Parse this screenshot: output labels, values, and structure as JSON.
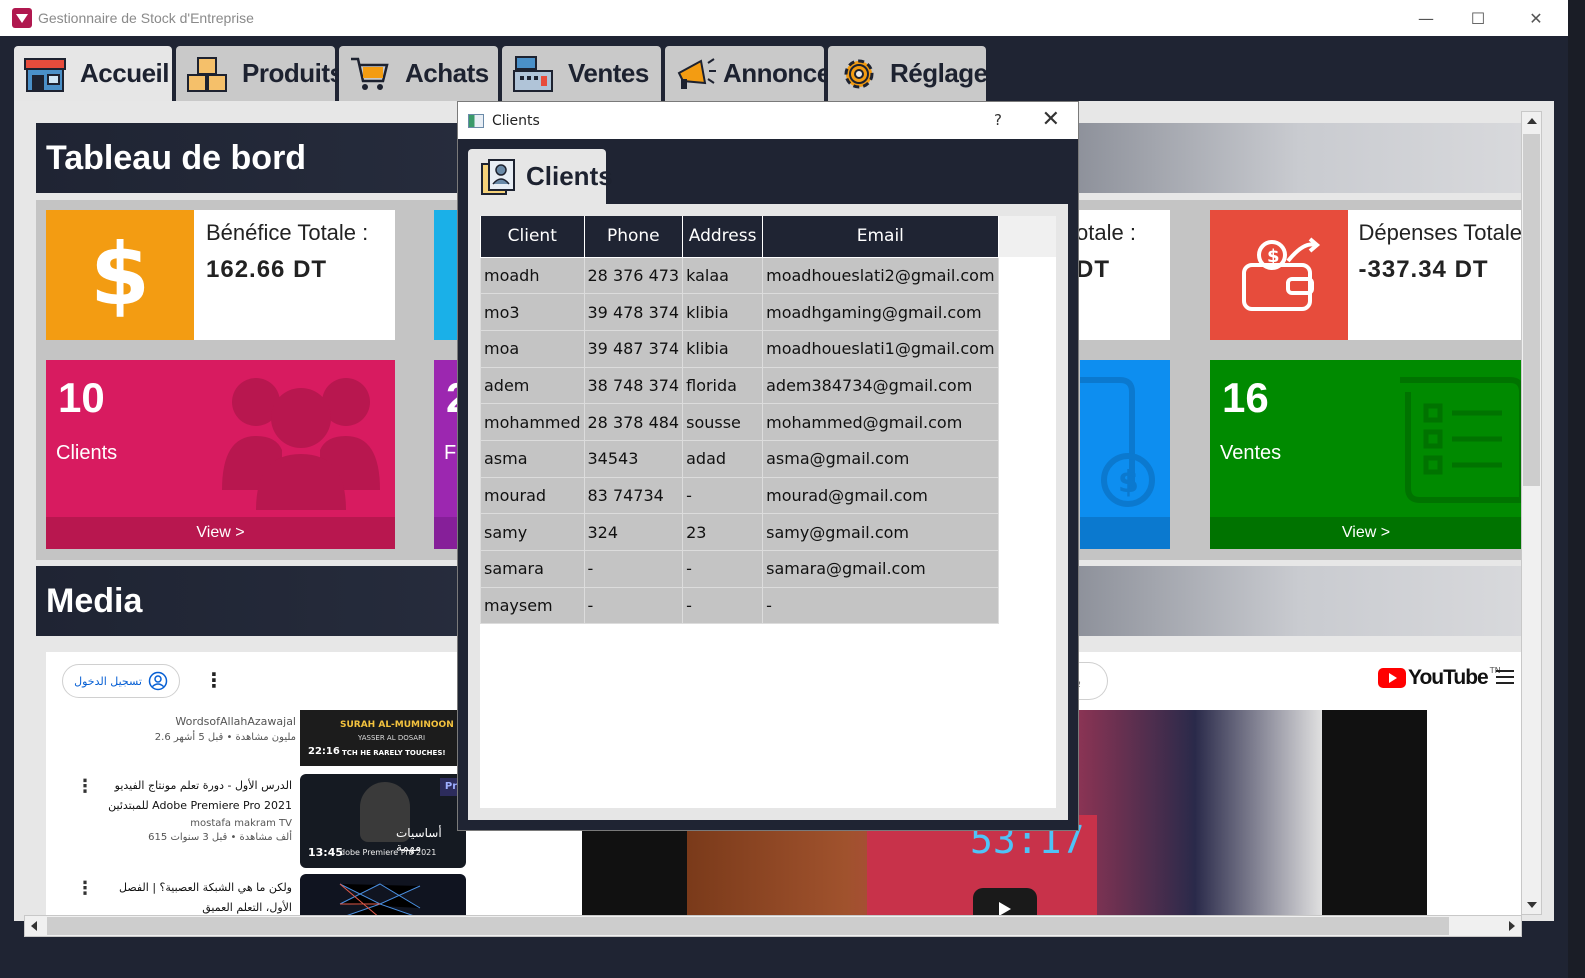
{
  "app": {
    "title": "Gestionnaire de Stock d'Entreprise",
    "controls": {
      "minimize": "—",
      "maximize": "☐",
      "close": "✕"
    }
  },
  "tabs": [
    {
      "label": "Accueil",
      "icon": "store-icon",
      "active": true
    },
    {
      "label": "Produits",
      "icon": "boxes-icon",
      "active": false
    },
    {
      "label": "Achats",
      "icon": "cart-icon",
      "active": false
    },
    {
      "label": "Ventes",
      "icon": "cash-register-icon",
      "active": false
    },
    {
      "label": "Annoncer",
      "icon": "megaphone-icon",
      "active": false
    },
    {
      "label": "Réglage",
      "icon": "gear-icon",
      "active": false
    }
  ],
  "dashboard": {
    "title": "Tableau de bord",
    "benefice": {
      "label": "Bénéfice Totale :",
      "value": "162.66  DT",
      "color": "#f39c12"
    },
    "partial_total": {
      "label": "otale :",
      "value": "DT"
    },
    "depenses": {
      "label": "Dépenses Totale",
      "value": "-337.34  DT",
      "color": "#e74c3c"
    },
    "clients_card": {
      "count": "10",
      "label": "Clients",
      "view": "View >",
      "color": "#d81b60"
    },
    "partial_card": {
      "count": "2",
      "label": "F"
    },
    "ventes_card": {
      "count": "16",
      "label": "Ventes",
      "view": "View >",
      "color": "#008a00"
    }
  },
  "media": {
    "title": "Media",
    "signin_label": "تسجيل الدخول",
    "search_partial": "بح",
    "youtube_logo": "YouTube",
    "youtube_tm": "TN",
    "videos": [
      {
        "channel": "WordsofAllahAzawajal",
        "meta": "2.6 مليون مشاهدة • قبل 5 أشهر",
        "duration": "22:16",
        "thumb_title": "SURAH AL-MUMINOON",
        "thumb_sub": "YASSER AL DOSARI",
        "thumb_caption": "TCH HE RARELY TOUCHES!"
      },
      {
        "title": "الدرس الأول - دورة تعلم مونتاج الفيديو للمبتدئين Adobe Premiere Pro 2021",
        "channel": "mostafa makram TV",
        "meta": "615 ألف مشاهدة • قبل 3 سنوات",
        "duration": "13:45",
        "thumb_title": "أساسيات مهمة",
        "thumb_sub": "dobe Premiere Pro 2021",
        "badge": "Pr"
      },
      {
        "title": "ولكن ما هي الشبكة العصبية؟ | الفصل الأول، التعلم العميق"
      }
    ],
    "player_timer": "53:17"
  },
  "dialog": {
    "title": "Clients",
    "help": "?",
    "close": "✕",
    "tab_label": "Clients",
    "table": {
      "columns": [
        "Client",
        "Phone",
        "Address",
        "Email"
      ],
      "rows": [
        [
          "moadh",
          "28 376 473",
          "kalaa",
          "moadhoueslati2@gmail.com"
        ],
        [
          "mo3",
          "39 478 374",
          "klibia",
          "moadhgaming@gmail.com"
        ],
        [
          "moa",
          "39 487 374",
          "klibia",
          "moadhoueslati1@gmail.com"
        ],
        [
          "adem",
          "38 748 374",
          "florida",
          "adem384734@gmail.com"
        ],
        [
          "mohammed",
          "28 378 484",
          "sousse",
          "mohammed@gmail.com"
        ],
        [
          "asma",
          "34543",
          "adad",
          "asma@gmail.com"
        ],
        [
          "mourad",
          "83 74734",
          "-",
          "mourad@gmail.com"
        ],
        [
          "samy",
          "324",
          "23",
          "samy@gmail.com"
        ],
        [
          "samara",
          "-",
          "-",
          "samara@gmail.com"
        ],
        [
          "maysem",
          "-",
          "-",
          "-"
        ]
      ]
    }
  }
}
